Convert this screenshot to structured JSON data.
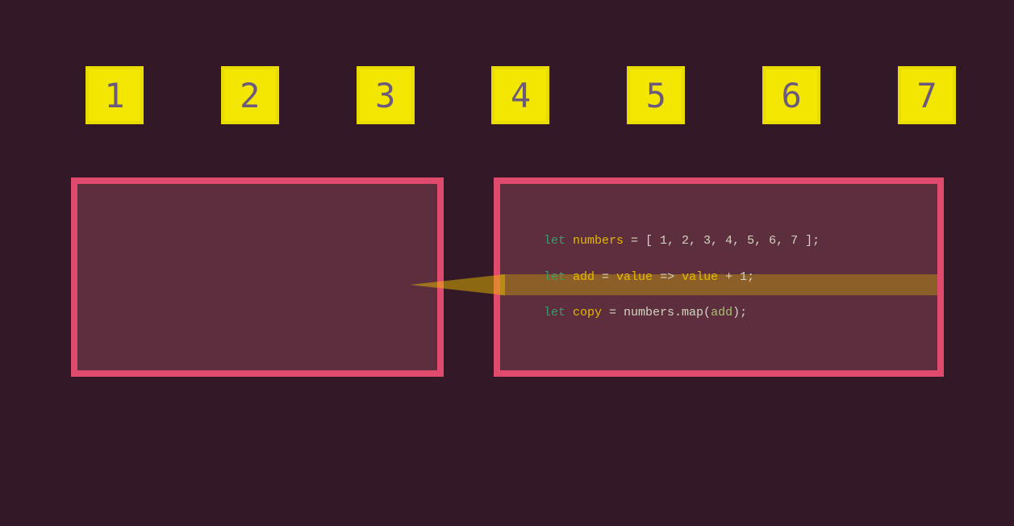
{
  "numbers": [
    "1",
    "2",
    "3",
    "4",
    "5",
    "6",
    "7"
  ],
  "code": {
    "line1": {
      "kw": "let ",
      "var": "numbers",
      "rest": " = [ ",
      "vals": "1, 2, 3, 4, 5, 6, 7",
      "end": " ];"
    },
    "line2": {
      "kw": "let ",
      "var1": "add",
      "mid1": " = ",
      "var2": "value",
      "mid2": " => ",
      "var3": "value",
      "end": " + 1;"
    },
    "line3": {
      "kw": "let ",
      "var": "copy",
      "mid": " = numbers.map(",
      "fn": "add",
      "end": ");"
    }
  }
}
